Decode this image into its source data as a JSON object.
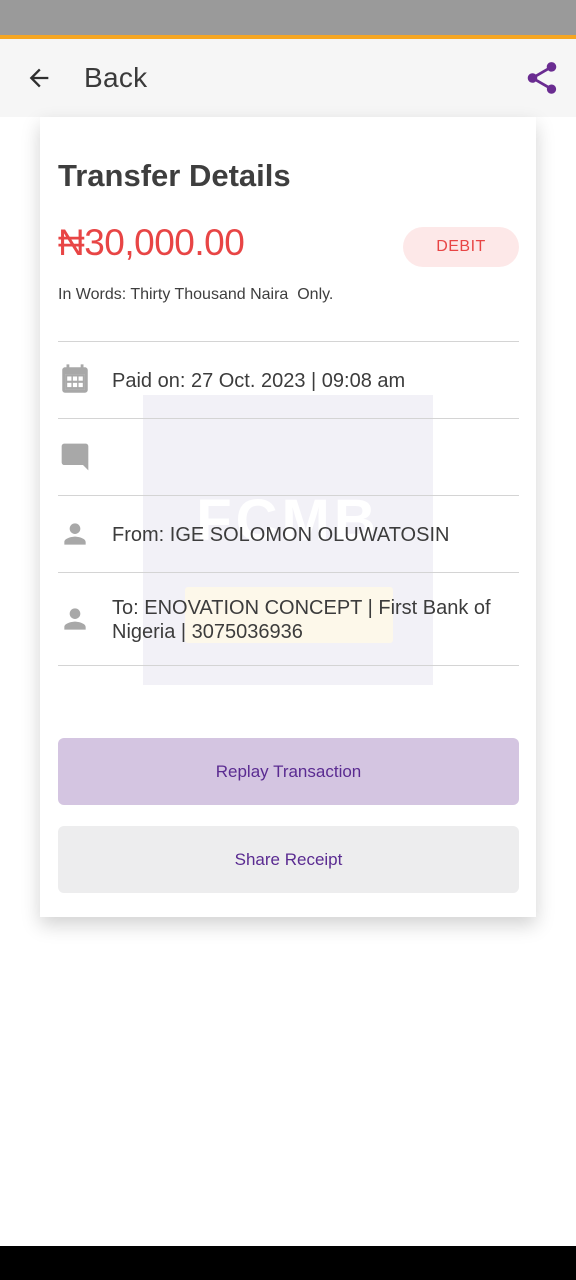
{
  "colors": {
    "status_bar": "#9a9a9a",
    "accent_line": "#f5a623",
    "share_icon": "#6a2c91",
    "amount": "#e84545",
    "icon_gray": "#a8a8a8"
  },
  "header": {
    "back_label": "Back",
    "back_icon": "arrow-left-icon",
    "share_icon": "share-icon"
  },
  "receipt": {
    "title": "Transfer Details",
    "amount": "₦30,000.00",
    "type_badge": "DEBIT",
    "in_words": "In Words: Thirty Thousand Naira  Only.",
    "watermark": "FCMB",
    "rows": [
      {
        "icon": "calendar-icon",
        "text": "Paid on: 27 Oct. 2023 | 09:08 am"
      },
      {
        "icon": "comment-icon",
        "text": ""
      },
      {
        "icon": "person-icon",
        "text": "From: IGE SOLOMON OLUWATOSIN"
      },
      {
        "icon": "person-icon",
        "text": "To: ENOVATION CONCEPT | First Bank of Nigeria | 3075036936"
      }
    ]
  },
  "actions": {
    "replay_label": "Replay Transaction",
    "share_label": "Share Receipt"
  }
}
